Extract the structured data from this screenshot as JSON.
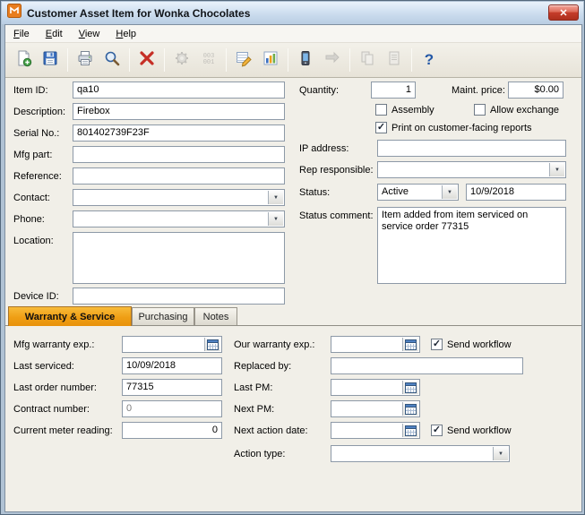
{
  "window": {
    "title": "Customer Asset Item for Wonka Chocolates"
  },
  "glyphs": {
    "close": "✕",
    "dropdown": "▼",
    "help": "?"
  },
  "menu": {
    "items": [
      "File",
      "Edit",
      "View",
      "Help"
    ]
  },
  "toolbar": {
    "icons": [
      "new-record",
      "save",
      "print",
      "search",
      "delete",
      "settings",
      "serial-numbers",
      "edit-chart",
      "schedule",
      "equipment",
      "transfer",
      "copy",
      "notes",
      "help"
    ],
    "serial_top": "003",
    "serial_bottom": "001"
  },
  "form": {
    "item_id": {
      "label": "Item ID:",
      "value": "qa10"
    },
    "description": {
      "label": "Description:",
      "value": "Firebox"
    },
    "serial_no": {
      "label": "Serial No.:",
      "value": "801402739F23F"
    },
    "mfg_part": {
      "label": "Mfg  part:",
      "value": ""
    },
    "reference": {
      "label": "Reference:",
      "value": ""
    },
    "contact": {
      "label": "Contact:",
      "value": ""
    },
    "phone": {
      "label": "Phone:",
      "value": ""
    },
    "location": {
      "label": "Location:",
      "value": ""
    },
    "device_id": {
      "label": "Device ID:",
      "value": ""
    },
    "quantity": {
      "label": "Quantity:",
      "value": "1"
    },
    "maint_price": {
      "label": "Maint. price:",
      "value": "$0.00"
    },
    "assembly": {
      "label": "Assembly",
      "mark": ""
    },
    "allow_exchange": {
      "label": "Allow exchange",
      "mark": ""
    },
    "print_reports": {
      "label": "Print on customer-facing reports",
      "mark": "✓"
    },
    "ip_address": {
      "label": "IP address:",
      "value": ""
    },
    "rep_responsible": {
      "label": "Rep responsible:",
      "value": ""
    },
    "status": {
      "label": "Status:",
      "value": "Active",
      "date": "10/9/2018"
    },
    "status_comment": {
      "label": "Status comment:",
      "value": "Item added from item serviced on service order 77315"
    }
  },
  "tabs": {
    "items": [
      {
        "label": "Warranty & Service",
        "active": true
      },
      {
        "label": "Purchasing",
        "active": false
      },
      {
        "label": "Notes",
        "active": false
      }
    ]
  },
  "warranty": {
    "mfg_warranty_exp": {
      "label": "Mfg warranty exp.:",
      "value": ""
    },
    "last_serviced": {
      "label": "Last serviced:",
      "value": "10/09/2018"
    },
    "last_order_number": {
      "label": "Last order number:",
      "value": "77315"
    },
    "contract_number": {
      "label": "Contract number:",
      "value": "0"
    },
    "current_meter_reading": {
      "label": "Current meter reading:",
      "value": "0"
    },
    "our_warranty_exp": {
      "label": "Our warranty exp.:",
      "value": ""
    },
    "send_workflow_warranty": {
      "label": "Send workflow",
      "mark": "✓"
    },
    "replaced_by": {
      "label": "Replaced by:",
      "value": ""
    },
    "last_pm": {
      "label": "Last PM:",
      "value": ""
    },
    "next_pm": {
      "label": "Next PM:",
      "value": ""
    },
    "next_action_date": {
      "label": "Next action date:",
      "value": ""
    },
    "send_workflow_action": {
      "label": "Send workflow",
      "mark": "✓"
    },
    "action_type": {
      "label": "Action type:",
      "value": ""
    }
  }
}
